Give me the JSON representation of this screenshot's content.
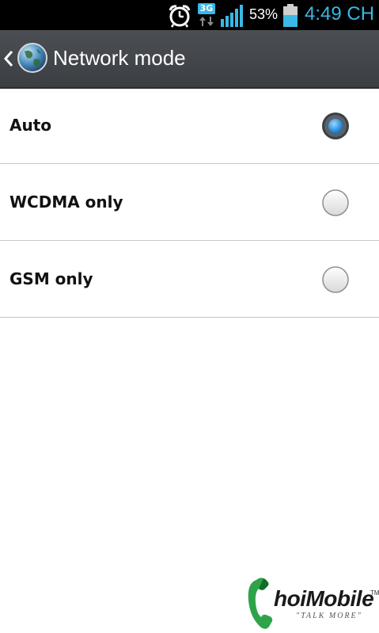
{
  "status_bar": {
    "network_type": "3G",
    "battery_percent": "53%",
    "time": "4:49 CH",
    "icons": [
      "alarm-icon",
      "3g-data-icon",
      "signal-icon",
      "battery-icon"
    ],
    "time_color": "#3ab8e6"
  },
  "action_bar": {
    "title": "Network mode",
    "icons": [
      "back-chevron-icon",
      "globe-icon"
    ]
  },
  "options": [
    {
      "label": "Auto",
      "selected": true
    },
    {
      "label": "WCDMA only",
      "selected": false
    },
    {
      "label": "GSM only",
      "selected": false
    }
  ],
  "watermark": {
    "brand": "hoiMobile",
    "tm": "TM",
    "tagline": "\"TALK MORE\""
  }
}
